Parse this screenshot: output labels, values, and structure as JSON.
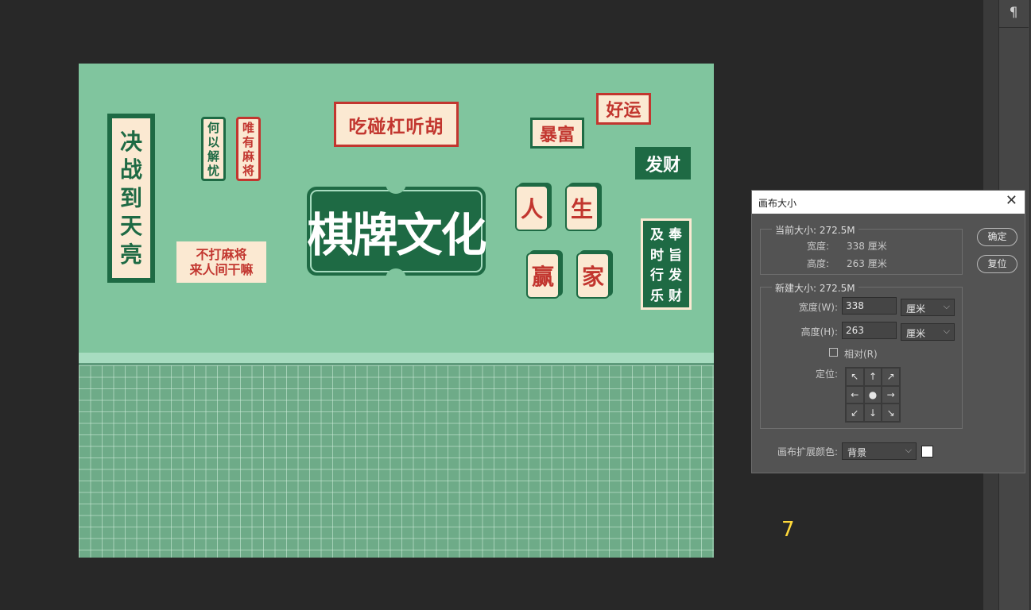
{
  "panel": {
    "paragraph_glyph": "¶"
  },
  "artwork": {
    "banner_left": [
      "决",
      "战",
      "到",
      "天",
      "亮"
    ],
    "banner_small_green": [
      "何",
      "以",
      "解",
      "忧"
    ],
    "banner_small_red": [
      "唯",
      "有",
      "麻",
      "将"
    ],
    "sign_top": "吃碰杠听胡",
    "sign_left_bottom": [
      "不打麻将",
      "来人间干嘛"
    ],
    "main_title": "棋牌文化",
    "sign_fu_gui": "暴富",
    "sign_hao_yun": "好运",
    "sign_fa_cai": "发财",
    "tiles": [
      "人",
      "生",
      "赢",
      "家"
    ],
    "banner_right_col1": [
      "奉",
      "旨",
      "发",
      "财"
    ],
    "banner_right_col2": [
      "及",
      "时",
      "行",
      "乐"
    ],
    "colors": {
      "green": "#1e6a44",
      "red": "#c2362f",
      "cream": "#fbe9d2",
      "mint": "#80c59e"
    }
  },
  "dialog": {
    "title": "画布大小",
    "close_icon": "close-icon",
    "current_size_label": "当前大小: 272.5M",
    "width_label": "宽度:",
    "width_value": "338 厘米",
    "height_label": "高度:",
    "height_value": "263 厘米",
    "new_size_label": "新建大小: 272.5M",
    "new_width_label": "宽度(W):",
    "new_width_value": "338",
    "new_height_label": "高度(H):",
    "new_height_value": "263",
    "unit": "厘米",
    "relative_label": "相对(R)",
    "anchor_label": "定位:",
    "anchor_arrows": [
      "↖",
      "↑",
      "↗",
      "←",
      "●",
      "→",
      "↙",
      "↓",
      "↘"
    ],
    "extension_color_label": "画布扩展颜色:",
    "extension_color_value": "背景",
    "ok_button": "确定",
    "reset_button": "复位"
  },
  "overlay": {
    "step_number": "7"
  }
}
